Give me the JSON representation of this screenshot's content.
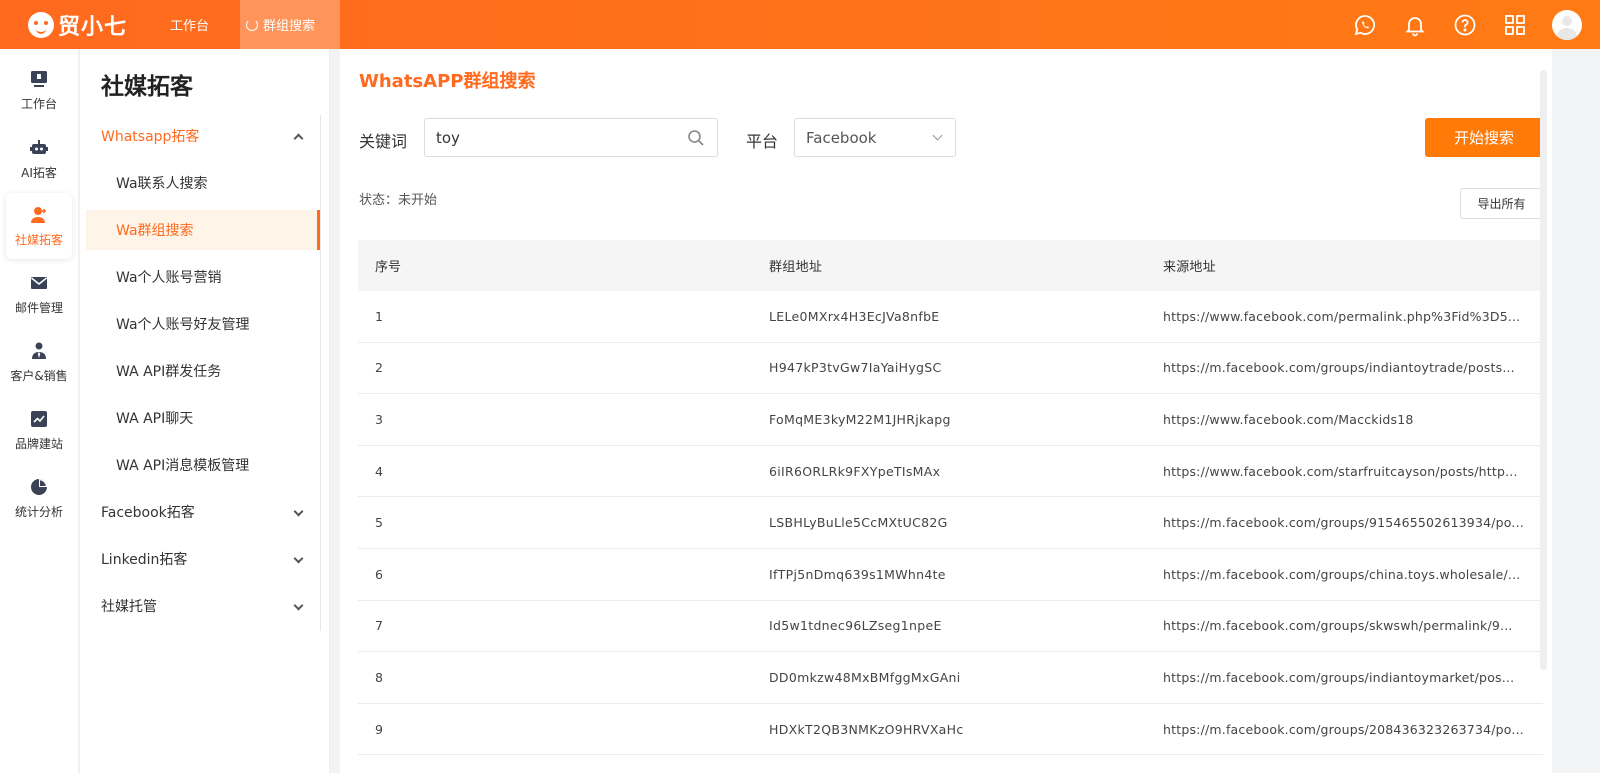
{
  "brand": {
    "name": "贸小七"
  },
  "top_tabs": [
    {
      "label": "工作台"
    },
    {
      "label": "群组搜索"
    }
  ],
  "top_icons": [
    "whatsapp-icon",
    "bell-icon",
    "help-icon",
    "grid-icon",
    "avatar"
  ],
  "rail": [
    {
      "label": "工作台",
      "icon": "monitor-icon"
    },
    {
      "label": "AI拓客",
      "icon": "robot-icon"
    },
    {
      "label": "社媒拓客",
      "icon": "user-plus-icon"
    },
    {
      "label": "邮件管理",
      "icon": "mail-icon"
    },
    {
      "label": "客户&销售",
      "icon": "person-tie-icon"
    },
    {
      "label": "品牌建站",
      "icon": "chart-line-icon"
    },
    {
      "label": "统计分析",
      "icon": "pie-icon"
    }
  ],
  "menu": {
    "title": "社媒拓客",
    "groups": [
      {
        "label": "Whatsapp拓客"
      },
      {
        "label": "Facebook拓客"
      },
      {
        "label": "Linkedin拓客"
      },
      {
        "label": "社媒托管"
      }
    ],
    "subs": [
      {
        "label": "Wa联系人搜索"
      },
      {
        "label": "Wa群组搜索"
      },
      {
        "label": "Wa个人账号营销"
      },
      {
        "label": "Wa个人账号好友管理"
      },
      {
        "label": "WA API群发任务"
      },
      {
        "label": "WA API聊天"
      },
      {
        "label": "WA API消息模板管理"
      }
    ]
  },
  "main": {
    "title": "WhatsAPP群组搜索",
    "keyword_label": "关键词",
    "keyword_value": "toy",
    "platform_label": "平台",
    "platform_value": "Facebook",
    "search_button": "开始搜索",
    "status": "状态：未开始",
    "export_button": "导出所有"
  },
  "table": {
    "headers": [
      "序号",
      "群组地址",
      "来源地址"
    ],
    "rows": [
      [
        "1",
        "LELe0MXrx4H3EcJVa8nfbE",
        "https://www.facebook.com/permalink.php%3Fid%3D5..."
      ],
      [
        "2",
        "H947kP3tvGw7IaYaiHygSC",
        "https://m.facebook.com/groups/indiantoytrade/posts..."
      ],
      [
        "3",
        "FoMqME3kyM22M1JHRjkapg",
        "https://www.facebook.com/Macckids18"
      ],
      [
        "4",
        "6iIR6ORLRk9FXYpeTIsMAx",
        "https://www.facebook.com/starfruitcayson/posts/http..."
      ],
      [
        "5",
        "LSBHLyBuLle5CcMXtUC82G",
        "https://m.facebook.com/groups/915465502613934/po..."
      ],
      [
        "6",
        "IfTPj5nDmq639s1MWhn4te",
        "https://m.facebook.com/groups/china.toys.wholesale/..."
      ],
      [
        "7",
        "Id5w1tdnec96LZseg1npeE",
        "https://m.facebook.com/groups/skwswh/permalink/9..."
      ],
      [
        "8",
        "DD0mkzw48MxBMfggMxGAni",
        "https://m.facebook.com/groups/indiantoymarket/pos..."
      ],
      [
        "9",
        "HDXkT2QB3NMKzO9HRVXaHc",
        "https://m.facebook.com/groups/208436323263734/po..."
      ]
    ]
  },
  "colors": {
    "accent": "#ff6a1f",
    "button": "#ff7a08",
    "active_bg": "#fff4e8"
  }
}
